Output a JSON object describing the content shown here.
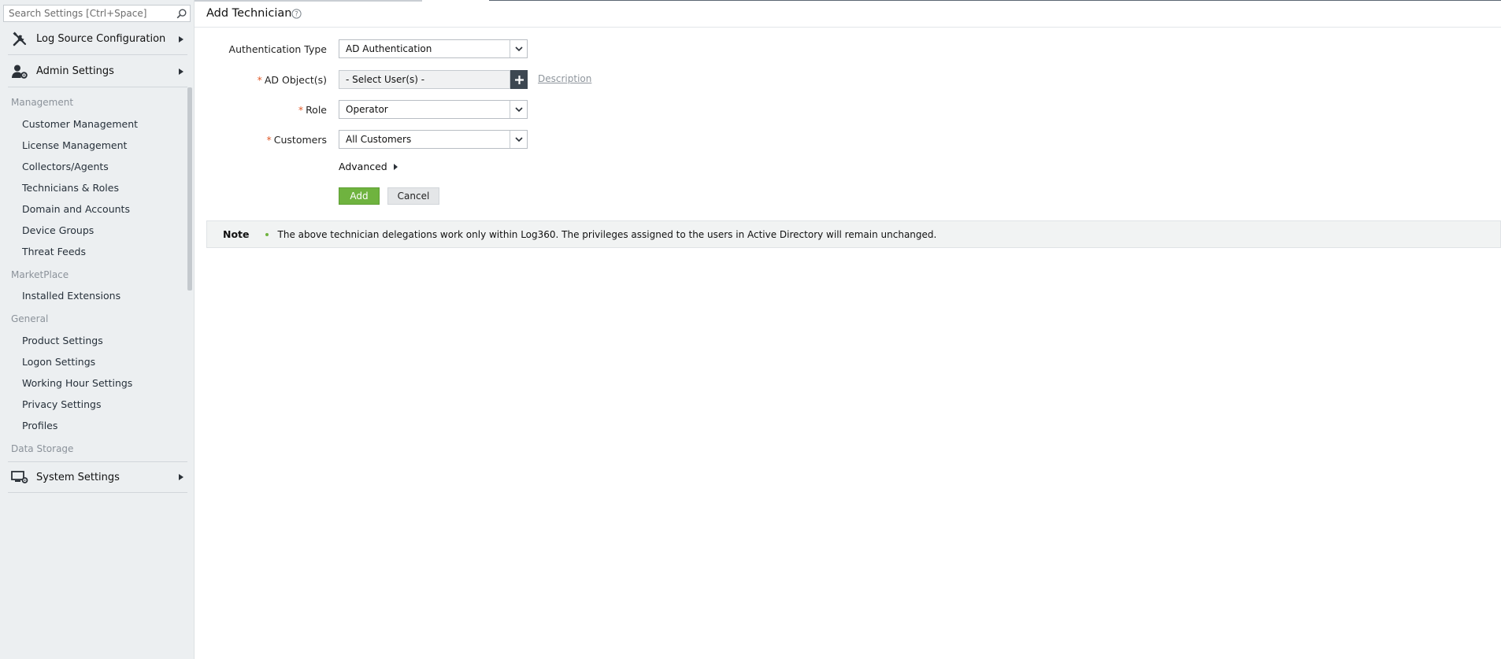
{
  "sidebar": {
    "search": {
      "placeholder": "Search Settings [Ctrl+Space]",
      "icon": "search-icon"
    },
    "sections": {
      "log_source": {
        "label": "Log Source Configuration",
        "icon": "tools-icon"
      },
      "admin": {
        "label": "Admin Settings",
        "icon": "admin-user-gear-icon"
      },
      "system": {
        "label": "System Settings",
        "icon": "monitor-gear-icon"
      }
    },
    "groups": [
      {
        "title": "Management",
        "items": [
          "Customer Management",
          "License Management",
          "Collectors/Agents",
          "Technicians & Roles",
          "Domain and Accounts",
          "Device Groups",
          "Threat Feeds"
        ]
      },
      {
        "title": "MarketPlace",
        "items": [
          "Installed Extensions"
        ]
      },
      {
        "title": "General",
        "items": [
          "Product Settings",
          "Logon Settings",
          "Working Hour Settings",
          "Privacy Settings",
          "Profiles"
        ]
      },
      {
        "title": "Data Storage",
        "items": []
      }
    ]
  },
  "main": {
    "title": "Add Technician",
    "form": {
      "auth_type": {
        "label": "Authentication Type",
        "value": "AD Authentication"
      },
      "ad_objects": {
        "label": "AD Object(s)",
        "required_mark": "*",
        "value": "- Select User(s) -",
        "description_link": "Description"
      },
      "role": {
        "label": "Role",
        "required_mark": "*",
        "value": "Operator"
      },
      "customers": {
        "label": "Customers",
        "required_mark": "*",
        "value": "All Customers"
      },
      "advanced_label": "Advanced",
      "add_label": "Add",
      "cancel_label": "Cancel"
    },
    "note": {
      "title": "Note",
      "text": "The above technician delegations work only within Log360. The privileges assigned to the users in Active Directory will remain unchanged."
    }
  },
  "colors": {
    "sidebar_bg": "#eceff1",
    "accent_green": "#6fb33f",
    "required_mark": "#e05a2a",
    "dark_button": "#3d4751"
  }
}
